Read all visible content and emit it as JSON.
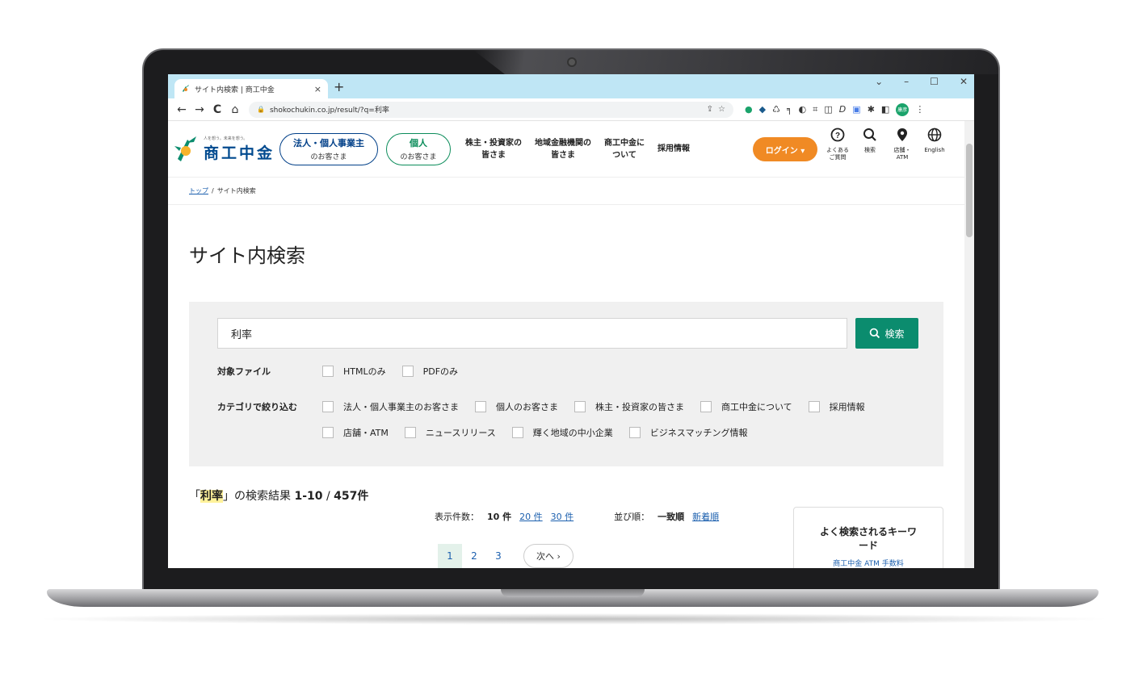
{
  "browser": {
    "tab_title": "サイト内検索 | 商工中金",
    "tab_close": "×",
    "new_tab": "+",
    "window_controls": [
      "⌄",
      "–",
      "☐",
      "✕"
    ],
    "back": "←",
    "forward": "→",
    "reload": "C",
    "home": "⌂",
    "url": "shokochukin.co.jp/result/?q=利率",
    "profile_label": "康彦"
  },
  "header": {
    "logo_tagline": "人を想う。未来を想う。",
    "logo_name": "商工中金",
    "nav_pills": [
      {
        "line1": "法人・個人事業主",
        "line2": "のお客さま"
      },
      {
        "line1": "個人",
        "line2": "のお客さま"
      }
    ],
    "nav_links": [
      {
        "line1": "株主・投資家の",
        "line2": "皆さま"
      },
      {
        "line1": "地域金融機関の",
        "line2": "皆さま"
      },
      {
        "line1": "商工中金に",
        "line2": "ついて"
      },
      {
        "line1": "採用情報",
        "line2": ""
      }
    ],
    "login_label": "ログイン ▾",
    "icons": [
      {
        "glyph": "?",
        "line1": "よくある",
        "line2": "ご質問"
      },
      {
        "glyph": "⚲",
        "line1": "検索",
        "line2": ""
      },
      {
        "glyph": "⚲",
        "line1": "店舗・",
        "line2": "ATM"
      },
      {
        "glyph": "⊕",
        "line1": "English",
        "line2": ""
      }
    ]
  },
  "breadcrumb": {
    "home": "トップ",
    "separator": "/",
    "current": "サイト内検索"
  },
  "page_title": "サイト内検索",
  "search": {
    "value": "利率",
    "button_label": "検索",
    "file_filter_label": "対象ファイル",
    "file_filters": [
      "HTMLのみ",
      "PDFのみ"
    ],
    "category_label": "カテゴリで絞り込む",
    "categories_row1": [
      "法人・個人事業主のお客さま",
      "個人のお客さま",
      "株主・投資家の皆さま",
      "商工中金について",
      "採用情報"
    ],
    "categories_row2": [
      "店舗・ATM",
      "ニュースリリース",
      "輝く地域の中小企業",
      "ビジネスマッチング情報"
    ]
  },
  "results": {
    "open_quote": "「",
    "keyword": "利率",
    "close_quote": "」の検索結果",
    "range": "1-10",
    "slash": "/",
    "total": "457件",
    "per_page_label": "表示件数：",
    "per_page_current": "10 件",
    "per_page_options": [
      "20 件",
      "30 件"
    ],
    "sort_label": "並び順：",
    "sort_current": "一致順",
    "sort_option": "新着順",
    "pages": [
      "1",
      "2",
      "3"
    ],
    "next_label": "次へ ›"
  },
  "keyword_box": {
    "title": "よく検索されるキーワード",
    "partial": "商工中金 ATM 手数料"
  },
  "colors": {
    "brand_blue": "#004a8f",
    "brand_green": "#0b8c6e",
    "login_orange": "#f08a24",
    "tabbar": "#bfe6f5"
  }
}
